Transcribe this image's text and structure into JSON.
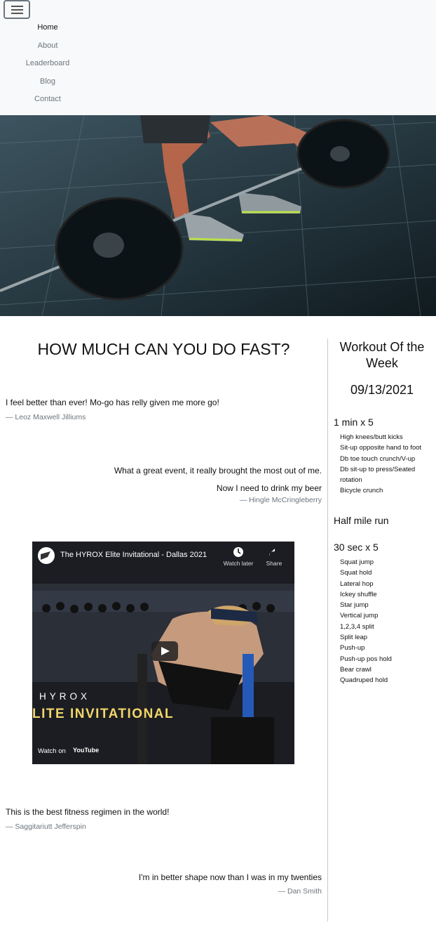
{
  "nav": {
    "items": [
      {
        "label": "Home"
      },
      {
        "label": "About"
      },
      {
        "label": "Leaderboard"
      },
      {
        "label": "Blog"
      },
      {
        "label": "Contact"
      }
    ]
  },
  "main": {
    "headline": "HOW MUCH CAN YOU DO FAST?",
    "testimonials": [
      {
        "quote": "I feel better than ever! Mo-go has relly given me more go!",
        "author": "— Leoz Maxwell Jilliums"
      },
      {
        "quote": "What a great event, it really brought the most out of me. Now I need to drink my beer",
        "author": "— Hingle McCringleberry"
      },
      {
        "quote": "This is the best fitness regimen in the world!",
        "author": "— Saggitariutt Jefferspin"
      },
      {
        "quote": "I'm in better shape now than I was in my twenties",
        "author": "— Dan Smith"
      }
    ],
    "video": {
      "title": "The HYROX Elite Invitational - Dallas 2021",
      "watch_later": "Watch later",
      "share": "Share",
      "watch_on": "Watch on",
      "youtube": "YouTube",
      "brand": "HYROX",
      "banner": "LITE INVITATIONAL"
    }
  },
  "sidebar": {
    "title": "Workout Of the Week",
    "date": "09/13/2021",
    "sections": [
      {
        "heading": "1 min x 5",
        "items": [
          "High knees/butt kicks",
          "Sit-up opposite hand to foot",
          "Db toe touch crunch/V-up",
          "Db sit-up to press/Seated rotation",
          "Bicycle crunch"
        ]
      },
      {
        "heading": "Half mile run",
        "items": []
      },
      {
        "heading": "30 sec x 5",
        "items": [
          "Squat jump",
          "Squat hold",
          "Lateral hop",
          "Ickey shuffle",
          "Star jump",
          "Vertical jump",
          "1,2,3,4 split",
          "Split leap",
          "Push-up",
          "Push-up pos hold",
          "Bear crawl",
          "Quadruped hold"
        ]
      }
    ]
  }
}
